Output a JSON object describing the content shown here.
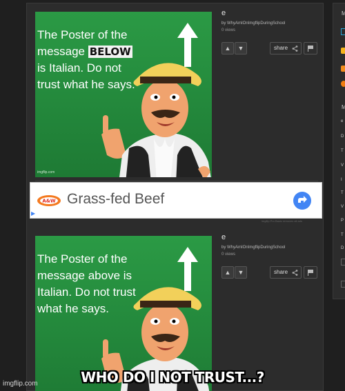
{
  "posts": [
    {
      "meme_text_before": "The Poster of the message ",
      "meme_text_highlight": "BELOW",
      "meme_text_after": " is Italian. Do not trust what he says.",
      "meme_watermark": "imgflip.com",
      "title": "e",
      "byline": "by WhyAmIOnImgflipDuringSchool",
      "views": "0 views",
      "share_label": "share"
    },
    {
      "meme_text_before": "The Poster of the message above is Italian. Do not trust what he says.",
      "title": "e",
      "byline": "by WhyAmIOnImgflipDuringSchool",
      "views": "0 views",
      "share_label": "share"
    }
  ],
  "ad": {
    "brand": "A&W",
    "title": "Grass-fed Beef",
    "caption": "imgflip Pro Basic removes all ads"
  },
  "right_column": {
    "letters": [
      "M",
      "M"
    ],
    "lines": [
      "e",
      "D",
      "T",
      "V",
      "I",
      "T",
      "V",
      "P",
      "T",
      "D"
    ]
  },
  "overlay": {
    "caption": "WHO DO I NOT TRUST...?",
    "watermark": "imgflip.com"
  },
  "colors": {
    "meme_green": "#23873b",
    "ad_button_blue": "#4285f4",
    "page_bg": "#1f1f1f",
    "panel_bg": "#2c2c2c"
  }
}
